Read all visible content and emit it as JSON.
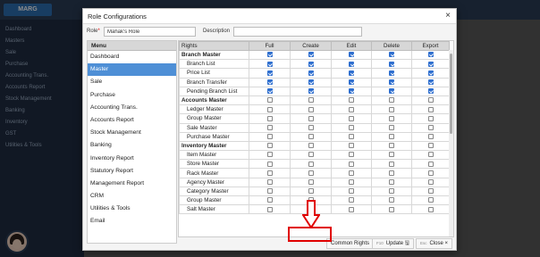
{
  "background": {
    "logo_text": "MARG",
    "sidebar_items": [
      "Dashboard",
      "Masters",
      "Sale",
      "Purchase",
      "Accounting Trans.",
      "Accounts Report",
      "Stock Management",
      "Banking",
      "Inventory",
      "GST",
      "Utilities & Tools"
    ]
  },
  "modal": {
    "title": "Role Configurations",
    "close_icon": "×",
    "role_label": "Role",
    "role_value": "Mahak's Role",
    "description_label": "Description",
    "description_value": ""
  },
  "menu": {
    "header": "Menu",
    "items": [
      "Dashboard",
      "Master",
      "Sale",
      "Purchase",
      "Accounting Trans.",
      "Accounts Report",
      "Stock Management",
      "Banking",
      "Inventory Report",
      "Statutory Report",
      "Management Report",
      "CRM",
      "Utilities & Tools",
      "Email"
    ],
    "active_index": 1
  },
  "table": {
    "columns": [
      "Rights",
      "Full",
      "Create",
      "Edit",
      "Delete",
      "Export"
    ],
    "rows": [
      {
        "label": "Branch Master",
        "section": true,
        "checks": [
          true,
          true,
          true,
          true,
          true
        ]
      },
      {
        "label": "Branch List",
        "section": false,
        "checks": [
          true,
          true,
          true,
          true,
          true
        ]
      },
      {
        "label": "Price List",
        "section": false,
        "checks": [
          true,
          true,
          true,
          true,
          true
        ]
      },
      {
        "label": "Branch Transfer",
        "section": false,
        "checks": [
          true,
          true,
          true,
          true,
          true
        ]
      },
      {
        "label": "Pending Branch List",
        "section": false,
        "checks": [
          true,
          true,
          true,
          true,
          true
        ]
      },
      {
        "label": "Accounts Master",
        "section": true,
        "checks": [
          false,
          false,
          false,
          false,
          false
        ]
      },
      {
        "label": "Ledger Master",
        "section": false,
        "checks": [
          false,
          false,
          false,
          false,
          false
        ]
      },
      {
        "label": "Group Master",
        "section": false,
        "checks": [
          false,
          false,
          false,
          false,
          false
        ]
      },
      {
        "label": "Sale Master",
        "section": false,
        "checks": [
          false,
          false,
          false,
          false,
          false
        ]
      },
      {
        "label": "Purchase Master",
        "section": false,
        "checks": [
          false,
          false,
          false,
          false,
          false
        ]
      },
      {
        "label": "Inventory Master",
        "section": true,
        "checks": [
          false,
          false,
          false,
          false,
          false
        ]
      },
      {
        "label": "Item Master",
        "section": false,
        "checks": [
          false,
          false,
          false,
          false,
          false
        ]
      },
      {
        "label": "Store Master",
        "section": false,
        "checks": [
          false,
          false,
          false,
          false,
          false
        ]
      },
      {
        "label": "Rack Master",
        "section": false,
        "checks": [
          false,
          false,
          false,
          false,
          false
        ]
      },
      {
        "label": "Agency Master",
        "section": false,
        "checks": [
          false,
          false,
          false,
          false,
          false
        ]
      },
      {
        "label": "Category Master",
        "section": false,
        "checks": [
          false,
          false,
          false,
          false,
          false
        ]
      },
      {
        "label": "Group Master",
        "section": false,
        "checks": [
          false,
          false,
          false,
          false,
          false
        ]
      },
      {
        "label": "Salt Master",
        "section": false,
        "checks": [
          false,
          false,
          false,
          false,
          false
        ]
      }
    ]
  },
  "footer": {
    "common_rights_label": "Common Rights",
    "update_key": "F10",
    "update_label": "Update",
    "close_key": "Esc",
    "close_label": "Close",
    "close_icon": "×"
  },
  "colors": {
    "accent": "#4e8fd6",
    "checkbox": "#2f6fcf",
    "highlight": "#e00000"
  }
}
